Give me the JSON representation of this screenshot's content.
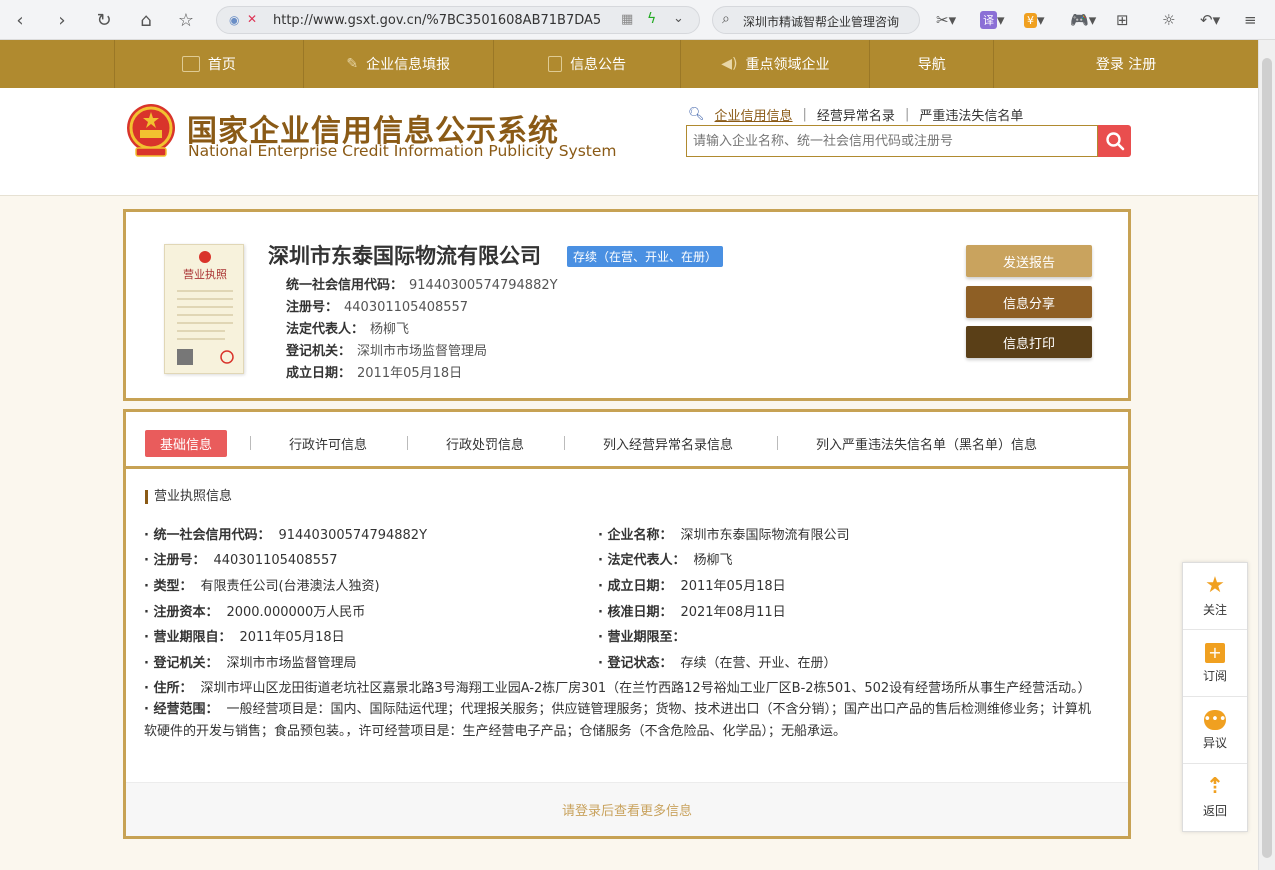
{
  "browser": {
    "url": "http://www.gsxt.gov.cn/%7BC3501608AB71B7DA5",
    "search_text": "深圳市精诚智帮企业管理咨询"
  },
  "nav": {
    "items": [
      "首页",
      "企业信息填报",
      "信息公告",
      "重点领域企业",
      "导航",
      "登录 注册"
    ]
  },
  "header": {
    "title": "国家企业信用信息公示系统",
    "subtitle": "National Enterprise Credit Information Publicity System",
    "search_tabs": [
      "企业信用信息",
      "经营异常名录",
      "严重违法失信名单"
    ],
    "search_placeholder": "请输入企业名称、统一社会信用代码或注册号"
  },
  "company": {
    "name": "深圳市东泰国际物流有限公司",
    "status": "存续（在营、开业、在册）",
    "fields": [
      {
        "label": "统一社会信用代码：",
        "value": "91440300574794882Y"
      },
      {
        "label": "注册号：",
        "value": "440301105408557"
      },
      {
        "label": "法定代表人：",
        "value": "杨柳飞"
      },
      {
        "label": "登记机关：",
        "value": "深圳市市场监督管理局"
      },
      {
        "label": "成立日期：",
        "value": "2011年05月18日"
      }
    ],
    "buttons": [
      "发送报告",
      "信息分享",
      "信息打印"
    ]
  },
  "tabs": [
    "基础信息",
    "行政许可信息",
    "行政处罚信息",
    "列入经营异常名录信息",
    "列入严重违法失信名单（黑名单）信息"
  ],
  "details": {
    "section_title": "营业执照信息",
    "left": [
      {
        "label": "· 统一社会信用代码：",
        "value": "91440300574794882Y"
      },
      {
        "label": "· 注册号：",
        "value": "440301105408557"
      },
      {
        "label": "· 类型：",
        "value": "有限责任公司(台港澳法人独资)"
      },
      {
        "label": "· 注册资本：",
        "value": "2000.000000万人民币"
      },
      {
        "label": "· 营业期限自：",
        "value": "2011年05月18日"
      },
      {
        "label": "· 登记机关：",
        "value": "深圳市市场监督管理局"
      }
    ],
    "right": [
      {
        "label": "· 企业名称：",
        "value": "深圳市东泰国际物流有限公司"
      },
      {
        "label": "· 法定代表人：",
        "value": "杨柳飞"
      },
      {
        "label": "· 成立日期：",
        "value": "2011年05月18日"
      },
      {
        "label": "· 核准日期：",
        "value": "2021年08月11日"
      },
      {
        "label": "· 营业期限至：",
        "value": ""
      },
      {
        "label": "· 登记状态：",
        "value": "存续（在营、开业、在册）"
      }
    ],
    "address": {
      "label": "· 住所：",
      "value": "深圳市坪山区龙田街道老坑社区嘉景北路3号海翔工业园A-2栋厂房301（在兰竹西路12号裕灿工业厂区B-2栋501、502设有经营场所从事生产经营活动。）"
    },
    "scope": {
      "label": "· 经营范围：",
      "value": "一般经营项目是：国内、国际陆运代理；代理报关服务；供应链管理服务；货物、技术进出口（不含分销）；国产出口产品的售后检测维修业务；计算机软硬件的开发与销售；食品预包装。，许可经营项目是：生产经营电子产品；仓储服务（不含危险品、化学品）；无船承运。"
    },
    "login_hint": "请登录后查看更多信息"
  },
  "side": [
    "关注",
    "订阅",
    "异议",
    "返回"
  ],
  "colors": {
    "gold": "#b08a2f",
    "border": "#c7a254",
    "brown": "#8a5a16",
    "red": "#e94e4e",
    "badge": "#4a90e2"
  }
}
